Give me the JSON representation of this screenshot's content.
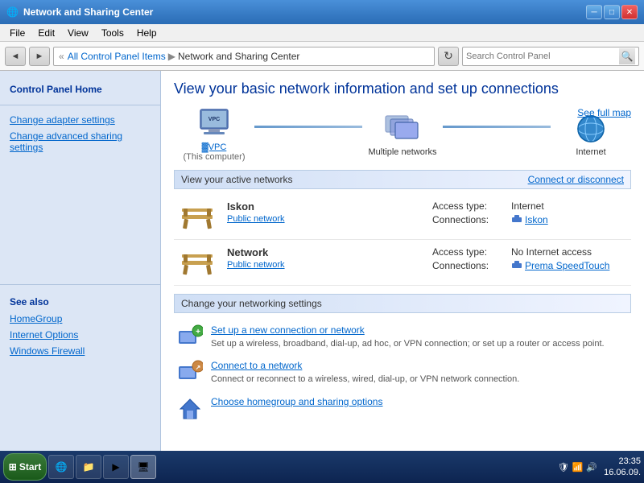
{
  "titlebar": {
    "title": "Network and Sharing Center",
    "minimize": "─",
    "maximize": "□",
    "close": "✕"
  },
  "menu": {
    "items": [
      "File",
      "Edit",
      "View",
      "Tools",
      "Help"
    ]
  },
  "addressbar": {
    "back": "◄",
    "forward": "►",
    "path_prefix": "«",
    "path_separator1": "All Control Panel Items",
    "path_arrow": "▶",
    "path_current": "Network and Sharing Center",
    "refresh": "↻",
    "search_placeholder": "Search Control Panel"
  },
  "sidebar": {
    "home_label": "Control Panel Home",
    "links": [
      "Change adapter settings",
      "Change advanced sharing settings"
    ],
    "see_also_label": "See also",
    "see_also_links": [
      "HomeGroup",
      "Internet Options",
      "Windows Firewall"
    ]
  },
  "content": {
    "title": "View your basic network information and set up connections",
    "see_full_map": "See full map",
    "network_map": {
      "node1_label": "▓VPC",
      "node1_sub": "(This computer)",
      "node2_label": "Multiple networks",
      "node3_label": "Internet"
    },
    "active_networks": {
      "header": "View your active networks",
      "connect_link": "Connect or disconnect",
      "networks": [
        {
          "name": "Iskon",
          "type": "Public network",
          "access_label": "Access type:",
          "access_value": "Internet",
          "conn_label": "Connections:",
          "conn_value": "Iskon"
        },
        {
          "name": "Network",
          "type": "Public network",
          "access_label": "Access type:",
          "access_value": "No Internet access",
          "conn_label": "Connections:",
          "conn_value": "Prema SpeedTouch"
        }
      ]
    },
    "change_settings": {
      "header": "Change your networking settings",
      "items": [
        {
          "link": "Set up a new connection or network",
          "desc": "Set up a wireless, broadband, dial-up, ad hoc, or VPN connection; or set up a router or access point."
        },
        {
          "link": "Connect to a network",
          "desc": "Connect or reconnect to a wireless, wired, dial-up, or VPN network connection."
        },
        {
          "link": "Choose homegroup and sharing options",
          "desc": ""
        }
      ]
    }
  },
  "taskbar": {
    "start_label": "Start",
    "clock_time": "23:35",
    "clock_date": "16.06.09."
  }
}
